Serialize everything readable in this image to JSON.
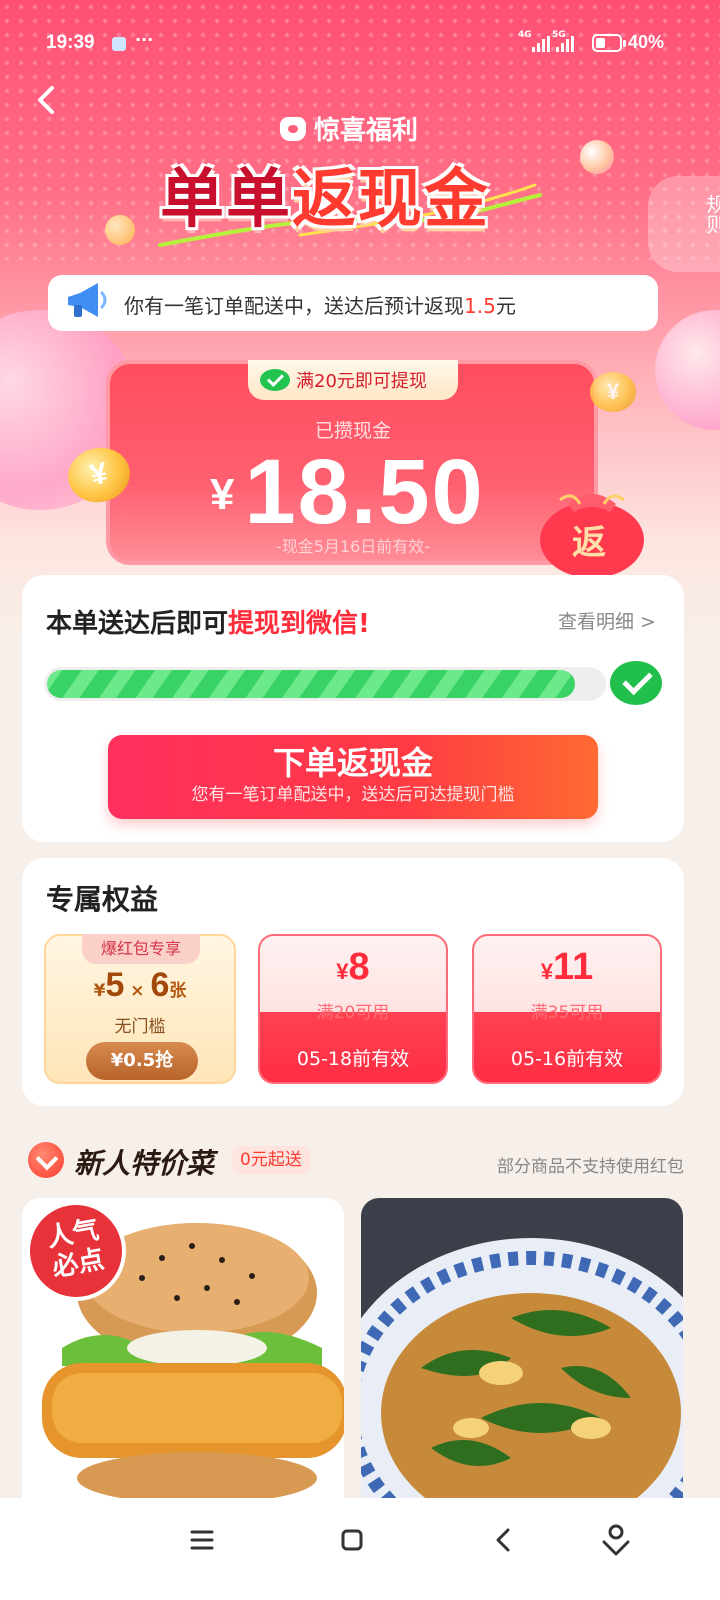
{
  "status_bar": {
    "time": "19:39",
    "net_1": "4G",
    "net_2": "5G",
    "battery_level": 0.4,
    "battery_pct": "40%"
  },
  "header": {
    "brand_label": "惊喜福利",
    "headline_part1": "单单",
    "headline_part2": "返现金",
    "rules_label": "规则"
  },
  "notice": {
    "text_prefix": "你有一笔订单配送中，送达后预计返现",
    "amount": "1.5",
    "text_suffix": "元"
  },
  "cash": {
    "threshold_pill": "满20元即可提现",
    "label": "已攒现金",
    "currency": "¥",
    "amount": "18.50",
    "expire": "-现金5月16日前有效-",
    "coin_symbol": "¥",
    "bag_label": "返"
  },
  "withdraw": {
    "title_prefix": "本单送达后即可",
    "title_highlight": "提现到微信!",
    "detail_link": "查看明细 >",
    "progress": 0.95,
    "cta_main": "下单返现金",
    "cta_sub": "您有一笔订单配送中，送达后可达提现门槛"
  },
  "perks": {
    "title": "专属权益",
    "gold": {
      "tag": "爆红包专享",
      "yen": "¥",
      "amount": "5",
      "times": " × ",
      "count": "6",
      "unit": "张",
      "subtitle": "无门槛",
      "button": "¥0.5抢"
    },
    "coupons": [
      {
        "yen": "¥",
        "amount": "8",
        "condition": "满20可用",
        "expire": "05-18前有效"
      },
      {
        "yen": "¥",
        "amount": "11",
        "condition": "满35可用",
        "expire": "05-16前有效"
      }
    ]
  },
  "newbie": {
    "title": "新人特价菜",
    "badge": "0元起送",
    "note": "部分商品不支持使用红包",
    "hot_badge_line1": "人气",
    "hot_badge_line2": "必点"
  },
  "colors": {
    "accent_red": "#ff2d3c",
    "wechat_green": "#23c34f",
    "gold": "#b25a10"
  }
}
